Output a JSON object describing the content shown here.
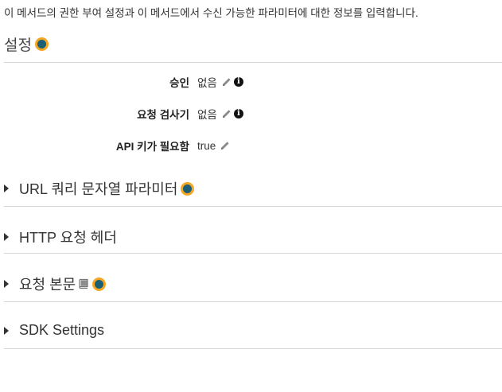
{
  "intro_text": "이 메서드의 권한 부여 설정과 이 메서드에서 수신 가능한 파라미터에 대한 정보를 입력합니다.",
  "settings": {
    "title": "설정",
    "rows": [
      {
        "label": "승인",
        "value": "없음"
      },
      {
        "label": "요청 검사기",
        "value": "없음"
      },
      {
        "label": "API 키가 필요함",
        "value": "true"
      }
    ]
  },
  "sections": [
    {
      "title": "URL 쿼리 문자열 파라미터"
    },
    {
      "title": "HTTP 요청 헤더"
    },
    {
      "title": "요청 본문"
    },
    {
      "title": "SDK Settings"
    }
  ],
  "colors": {
    "status_dot_fill": "#1b5f76",
    "status_dot_ring": "#f5a623",
    "divider": "#d5d5d5"
  },
  "icons": {
    "edit": "pencil-icon",
    "info": "info-icon",
    "expand": "caret-right-icon",
    "model": "book-icon",
    "status": "status-dot-icon"
  }
}
